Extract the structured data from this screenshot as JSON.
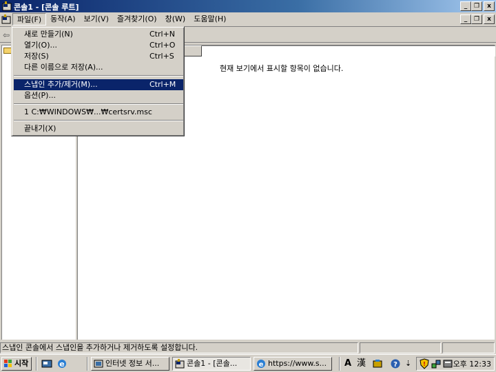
{
  "window": {
    "title": "콘솔1 - [콘솔 루트]",
    "caption_buttons": {
      "minimize": "_",
      "restore": "❐",
      "close": "x"
    }
  },
  "menubar": {
    "items": [
      {
        "label": "파일(F)"
      },
      {
        "label": "동작(A)"
      },
      {
        "label": "보기(V)"
      },
      {
        "label": "즐겨찾기(O)"
      },
      {
        "label": "창(W)"
      },
      {
        "label": "도움말(H)"
      }
    ]
  },
  "file_menu": {
    "items": [
      {
        "label": "새로 만들기(N)",
        "accel": "Ctrl+N"
      },
      {
        "label": "열기(O)...",
        "accel": "Ctrl+O"
      },
      {
        "label": "저장(S)",
        "accel": "Ctrl+S"
      },
      {
        "label": "다른 이름으로 저장(A)...",
        "accel": ""
      },
      {
        "label": "스냅인 추가/제거(M)...",
        "accel": "Ctrl+M",
        "selected": true
      },
      {
        "label": "옵션(P)...",
        "accel": ""
      },
      {
        "label": "1 C:₩WINDOWS₩...₩certsrv.msc",
        "accel": ""
      },
      {
        "label": "끝내기(X)",
        "accel": ""
      }
    ]
  },
  "result_pane": {
    "empty_message": "현재 보기에서 표시할 항목이 없습니다."
  },
  "statusbar": {
    "message": "스냅인 콘솔에서 스냅인을 추가하거나 제거하도록 설정합니다."
  },
  "taskbar": {
    "start_label": "시작",
    "tasks": [
      {
        "label": "인터넷 정보 서..."
      },
      {
        "label": "콘솔1 - [콘솔..."
      },
      {
        "label": "https://www.s..."
      }
    ],
    "ime": {
      "mode": "A",
      "hanja": "漢"
    },
    "clock": "오후 12:33"
  },
  "colors": {
    "selection": "#0a246a",
    "title_gradient_start": "#0a246a",
    "title_gradient_end": "#a6caf0",
    "face": "#d4d0c8"
  }
}
